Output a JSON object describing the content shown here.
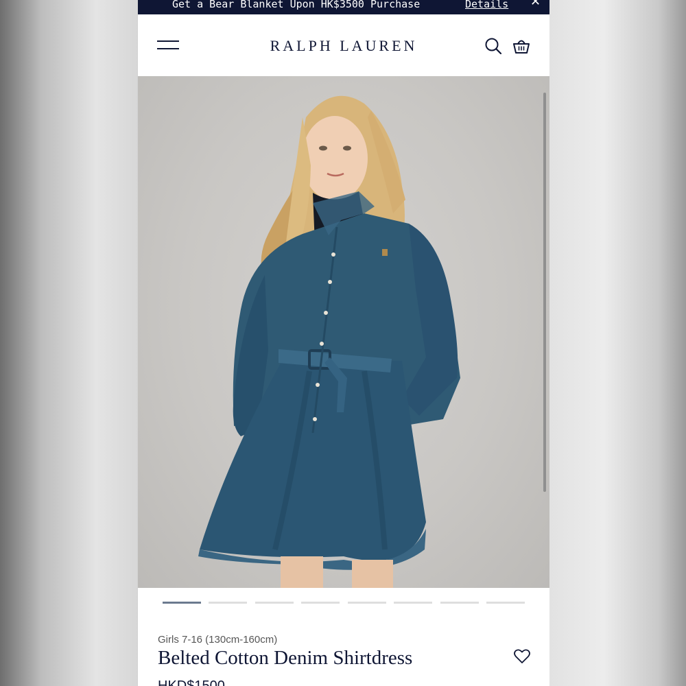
{
  "promo": {
    "message": "Get a Bear Blanket Upon HK$3500 Purchase",
    "link": "Details",
    "close_icon": "close-icon"
  },
  "header": {
    "brand": "RALPH LAUREN",
    "menu_icon": "hamburger-menu-icon",
    "search_icon": "search-icon",
    "bag_icon": "shopping-bag-icon"
  },
  "gallery": {
    "image_count": 8,
    "active_index": 0
  },
  "product": {
    "category": "Girls 7-16 (130cm-160cm)",
    "title": "Belted Cotton Denim Shirtdress",
    "price": "HKD$1500",
    "wishlist_icon": "heart-icon"
  },
  "colors": {
    "navy": "#0f1634",
    "denim": "#2f5a74"
  }
}
